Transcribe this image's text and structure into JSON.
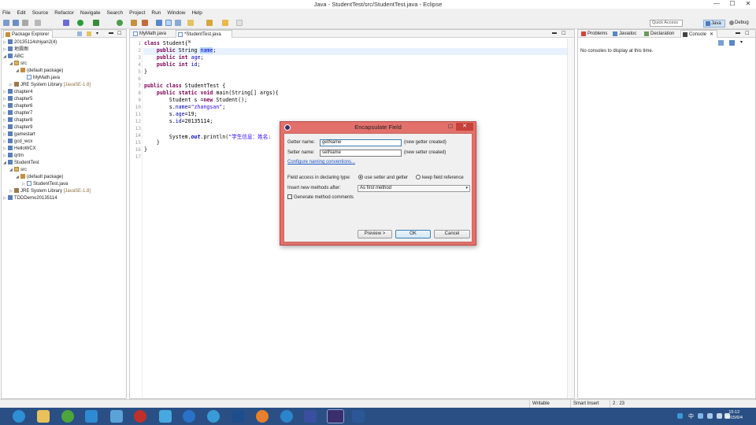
{
  "window": {
    "title": "Java - StudentTest/src/StudentTest.java - Eclipse",
    "controls": {
      "minimize": "—",
      "maximize": "☐",
      "close": "✕"
    }
  },
  "menu": [
    "File",
    "Edit",
    "Source",
    "Refactor",
    "Navigate",
    "Search",
    "Project",
    "Run",
    "Window",
    "Help"
  ],
  "toolbar": {
    "quick_access": "Quick Access",
    "perspectives": [
      "Java",
      "Debug"
    ]
  },
  "package_explorer": {
    "tab": "Package Explorer",
    "items": [
      {
        "label": "20135114shiyan2(4)",
        "icon": "project"
      },
      {
        "label": "地震图",
        "icon": "project"
      },
      {
        "label": "ABC",
        "icon": "project",
        "expanded": true
      },
      {
        "label": "src",
        "icon": "source-folder",
        "expanded": true
      },
      {
        "label": "(default package)",
        "icon": "package",
        "expanded": true
      },
      {
        "label": "MyMath.java",
        "icon": "java-file"
      },
      {
        "label": "JRE System Library",
        "suffix": "[JavaSE-1.8]",
        "icon": "library"
      },
      {
        "label": "chapter4",
        "icon": "project"
      },
      {
        "label": "chapter5",
        "icon": "project"
      },
      {
        "label": "chapter6",
        "icon": "project"
      },
      {
        "label": "chapter7",
        "icon": "project"
      },
      {
        "label": "chapter8",
        "icon": "project"
      },
      {
        "label": "chapter9",
        "icon": "project"
      },
      {
        "label": "gamestart",
        "icon": "project"
      },
      {
        "label": "gcd_wcx",
        "icon": "project"
      },
      {
        "label": "HelloWCX",
        "icon": "project"
      },
      {
        "label": "qrtm",
        "icon": "project"
      },
      {
        "label": "StudentTest",
        "icon": "project",
        "expanded": true
      },
      {
        "label": "src",
        "icon": "source-folder",
        "expanded": true
      },
      {
        "label": "(default package)",
        "icon": "package",
        "expanded": true
      },
      {
        "label": "StudentTest.java",
        "icon": "java-file"
      },
      {
        "label": "JRE System Library",
        "suffix": "[JavaSE-1.8]",
        "icon": "library"
      },
      {
        "label": "TDDDemo20135114",
        "icon": "project"
      }
    ]
  },
  "editor": {
    "tabs": [
      "MyMath.java",
      "*StudentTest.java"
    ],
    "line_numbers": [
      "1",
      "2",
      "3",
      "4",
      "5",
      "6",
      "7",
      "8",
      "9",
      "10",
      "11",
      "12",
      "13",
      "14",
      "15",
      "16",
      "17"
    ],
    "lines": [
      "class Student{",
      "    public String name;",
      "    public int age;",
      "    public int id;",
      "}",
      "",
      "public class StudentTest {",
      "    public static void main(String[] args){",
      "        Student s =new Student();",
      "        s.name=\"zhangsan\";",
      "        s.age=19;",
      "        s.id=20135114;",
      "",
      "        System.out.println(\"学生信息：姓名:",
      "    }",
      "}",
      ""
    ]
  },
  "right_panel": {
    "tabs": [
      "Problems",
      "Javadoc",
      "Declaration",
      "Console"
    ],
    "message": "No consoles to display at this time."
  },
  "dialog": {
    "title": "Encapsulate Field",
    "getter_label": "Getter name:",
    "getter_value": "getName",
    "getter_note": "(new getter created)",
    "setter_label": "Setter name:",
    "setter_value": "setName",
    "setter_note": "(new setter created)",
    "naming_link": "Configure naming conventions...",
    "access_label": "Field access in declaring type:",
    "access_opt1": "use setter and getter",
    "access_opt2": "keep field reference",
    "insert_label": "Insert new methods after:",
    "insert_value": "As first method",
    "comments_label": "Generate method comments",
    "preview_btn": "Preview >",
    "ok_btn": "OK",
    "cancel_btn": "Cancel"
  },
  "status": {
    "mode": "Writable",
    "insert": "Smart Insert",
    "position": "2 : 23"
  },
  "clock": {
    "time": "15:12",
    "date": "2015/6/4"
  },
  "tray": {
    "ime": "中",
    "ime2": "ン"
  }
}
